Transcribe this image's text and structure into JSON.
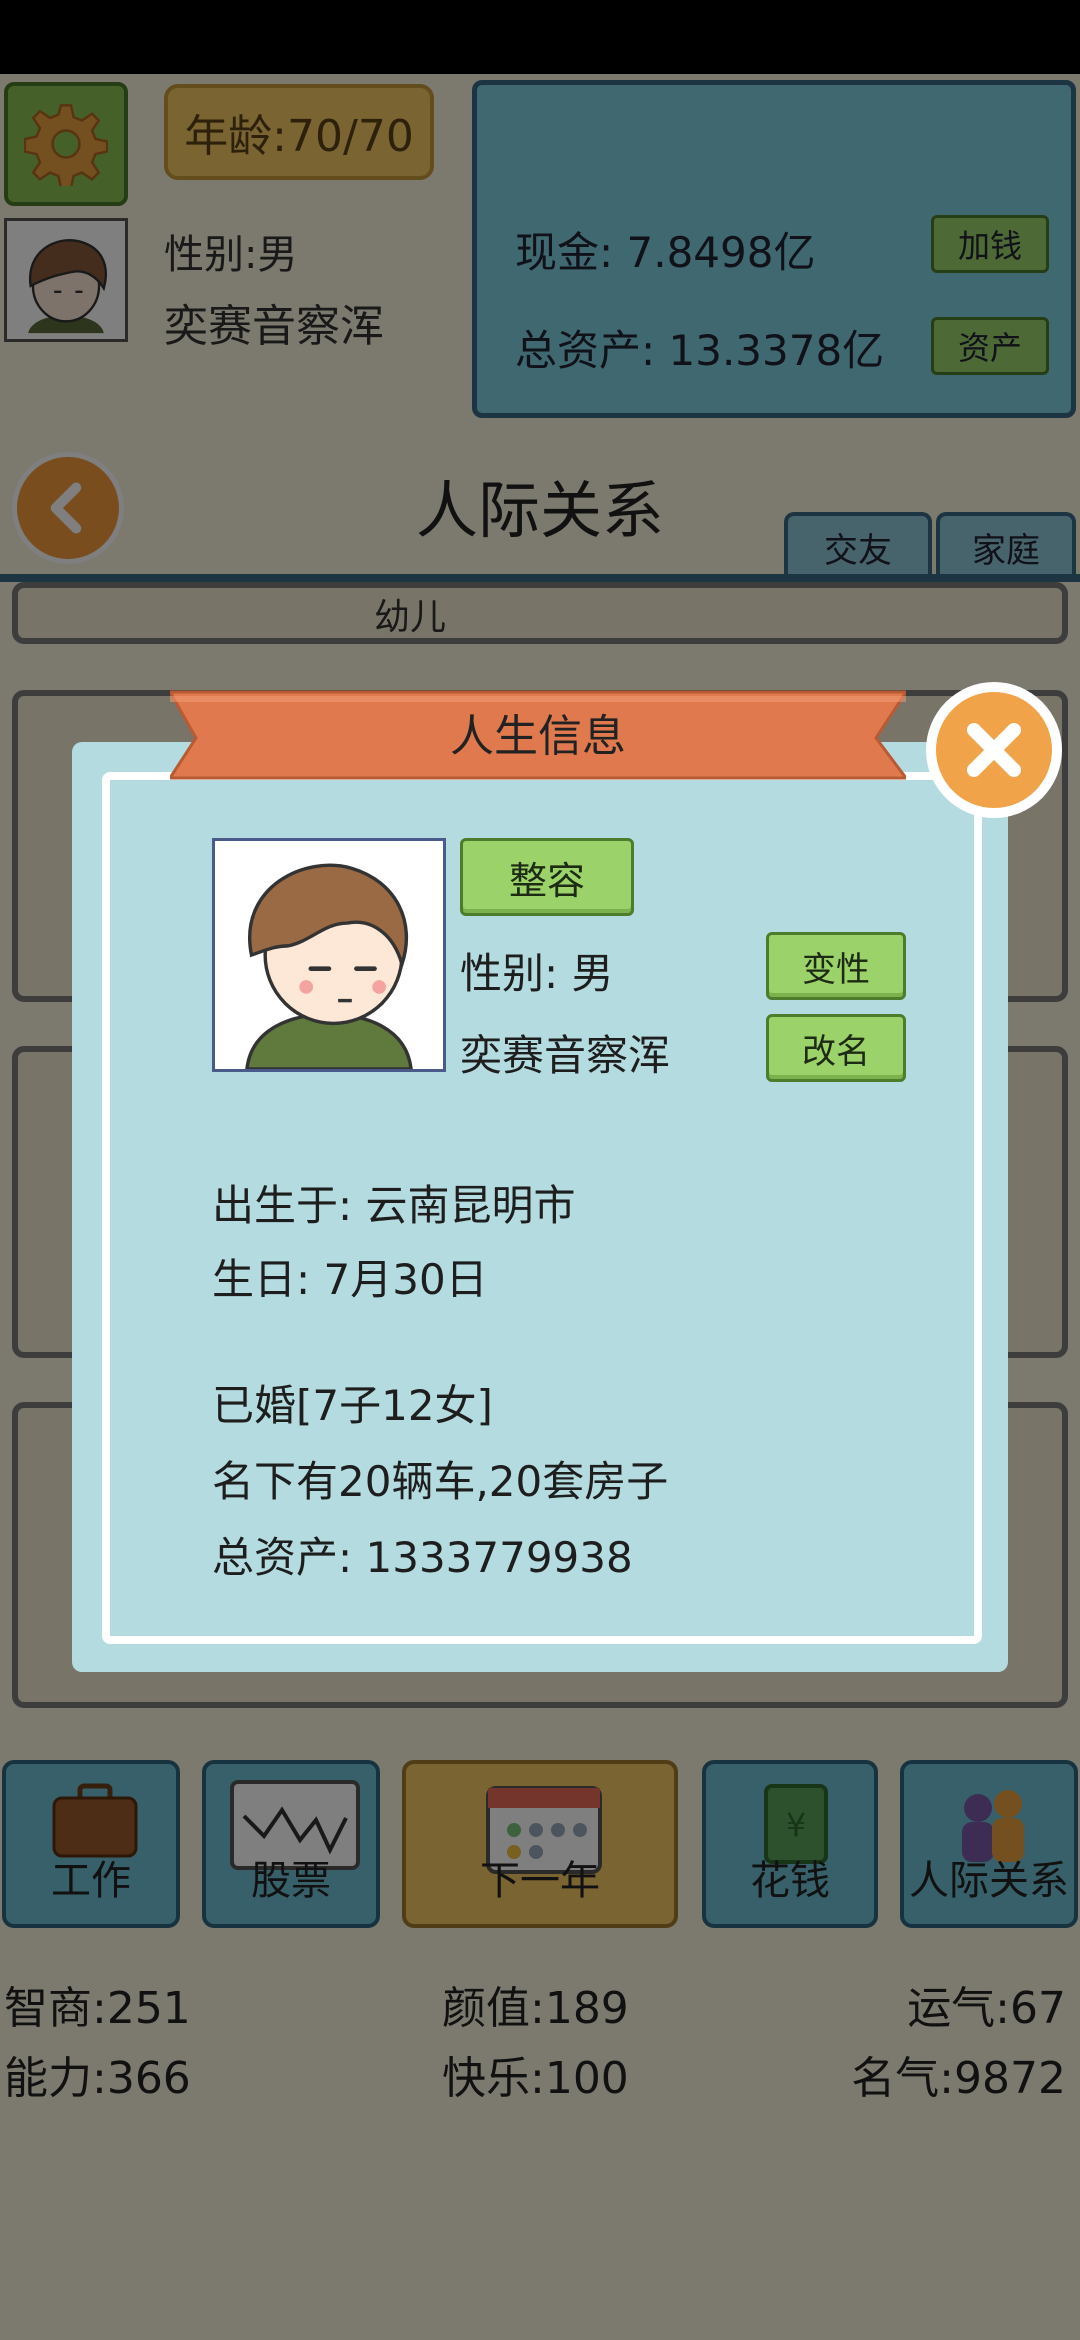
{
  "header": {
    "age": "年龄:70/70",
    "gender": "性别:男",
    "name": "奕赛音察浑",
    "cash": "现金: 7.8498亿",
    "total_assets": "总资产: 13.3378亿",
    "add_money_label": "加钱",
    "assets_label": "资产"
  },
  "page": {
    "title": "人际关系",
    "tabs": [
      "交友",
      "家庭"
    ],
    "partial_item": "幼儿"
  },
  "dialog": {
    "title": "人生信息",
    "plastic_surgery_label": "整容",
    "gender": "性别: 男",
    "change_gender_label": "变性",
    "name": "奕赛音察浑",
    "rename_label": "改名",
    "birthplace": "出生于: 云南昆明市",
    "birthday": "生日: 7月30日",
    "marital": "已婚[7子12女]",
    "property": "名下有20辆车,20套房子",
    "total_assets": "总资产: 1333779938"
  },
  "bottom_nav": [
    {
      "label": "工作",
      "icon": "briefcase-icon"
    },
    {
      "label": "股票",
      "icon": "stock-chart-icon"
    },
    {
      "label": "下一年",
      "icon": "calendar-icon"
    },
    {
      "label": "花钱",
      "icon": "money-icon"
    },
    {
      "label": "人际关系",
      "icon": "people-icon"
    }
  ],
  "stats": {
    "iq": "智商:251",
    "looks": "颜值:189",
    "luck": "运气:67",
    "ability": "能力:366",
    "happiness": "快乐:100",
    "fame": "名气:9872"
  },
  "colors": {
    "dialog_bg": "#b4dce0",
    "ribbon": "#e07a4e",
    "button_green": "#9bd36a",
    "close_orange": "#f0a348"
  }
}
